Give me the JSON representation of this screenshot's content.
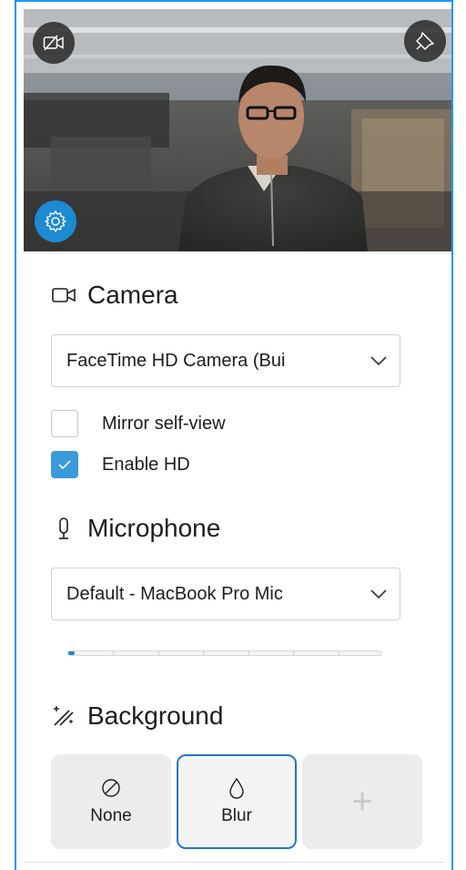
{
  "preview": {
    "buttons": {
      "camera_off_icon": "video-off-icon",
      "pin_icon": "pin-icon",
      "settings_icon": "gear-icon"
    }
  },
  "camera": {
    "heading": "Camera",
    "icon": "video-camera-icon",
    "selected_device": "FaceTime HD Camera (Bui",
    "options": [
      {
        "label": "Mirror self-view",
        "checked": false
      },
      {
        "label": "Enable HD",
        "checked": true
      }
    ]
  },
  "microphone": {
    "heading": "Microphone",
    "icon": "microphone-icon",
    "selected_device": "Default - MacBook Pro Mic",
    "level": 0.02
  },
  "background": {
    "heading": "Background",
    "icon": "magic-wand-icon",
    "options": [
      {
        "label": "None",
        "icon": "none-icon",
        "selected": false
      },
      {
        "label": "Blur",
        "icon": "blur-drop-icon",
        "selected": true
      },
      {
        "label": "",
        "icon": "plus-icon",
        "selected": false
      }
    ]
  },
  "colors": {
    "accent": "#1d8ad2",
    "selected_border": "#2276c9",
    "frame_border": "#1f96ff"
  }
}
